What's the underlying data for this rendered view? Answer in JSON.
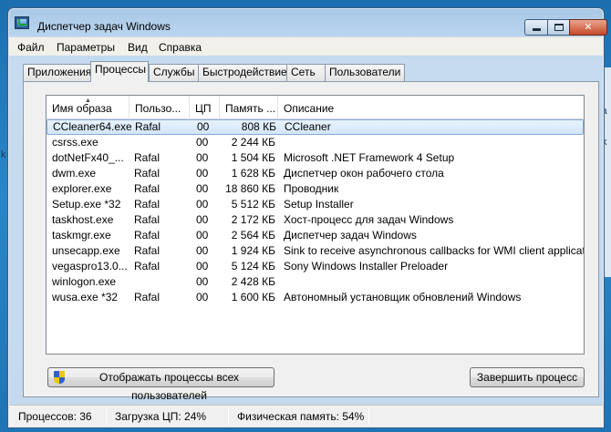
{
  "window": {
    "title": "Диспетчер задач Windows",
    "controls": {
      "minimize": "",
      "maximize": "",
      "close": "✕"
    }
  },
  "menu": [
    "Файл",
    "Параметры",
    "Вид",
    "Справка"
  ],
  "tabs": [
    "Приложения",
    "Процессы",
    "Службы",
    "Быстродействие",
    "Сеть",
    "Пользователи"
  ],
  "active_tab": "Процессы",
  "columns": [
    "Имя образа",
    "Пользо...",
    "ЦП",
    "Память ...",
    "Описание"
  ],
  "sort_indicator": "▲",
  "processes": [
    {
      "name": "CCleaner64.exe",
      "user": "Rafal",
      "cpu": "00",
      "mem": "808 КБ",
      "desc": "CCleaner"
    },
    {
      "name": "csrss.exe",
      "user": "",
      "cpu": "00",
      "mem": "2 244 КБ",
      "desc": ""
    },
    {
      "name": "dotNetFx40_...",
      "user": "Rafal",
      "cpu": "00",
      "mem": "1 504 КБ",
      "desc": "Microsoft .NET Framework 4 Setup"
    },
    {
      "name": "dwm.exe",
      "user": "Rafal",
      "cpu": "00",
      "mem": "1 628 КБ",
      "desc": "Диспетчер окон рабочего стола"
    },
    {
      "name": "explorer.exe",
      "user": "Rafal",
      "cpu": "00",
      "mem": "18 860 КБ",
      "desc": "Проводник"
    },
    {
      "name": "Setup.exe *32",
      "user": "Rafal",
      "cpu": "00",
      "mem": "5 512 КБ",
      "desc": "Setup Installer"
    },
    {
      "name": "taskhost.exe",
      "user": "Rafal",
      "cpu": "00",
      "mem": "2 172 КБ",
      "desc": "Хост-процесс для задач Windows"
    },
    {
      "name": "taskmgr.exe",
      "user": "Rafal",
      "cpu": "00",
      "mem": "2 564 КБ",
      "desc": "Диспетчер задач Windows"
    },
    {
      "name": "unsecapp.exe",
      "user": "Rafal",
      "cpu": "00",
      "mem": "1 924 КБ",
      "desc": "Sink to receive asynchronous callbacks for WMI client application"
    },
    {
      "name": "vegaspro13.0...",
      "user": "Rafal",
      "cpu": "00",
      "mem": "5 124 КБ",
      "desc": "Sony Windows Installer Preloader"
    },
    {
      "name": "winlogon.exe",
      "user": "",
      "cpu": "00",
      "mem": "2 428 КБ",
      "desc": ""
    },
    {
      "name": "wusa.exe *32",
      "user": "Rafal",
      "cpu": "00",
      "mem": "1 600 КБ",
      "desc": "Автономный установщик обновлений Windows"
    }
  ],
  "selected_index": 0,
  "buttons": {
    "show_all": "Отображать процессы всех пользователей",
    "end_process": "Завершить процесс"
  },
  "status": {
    "processes": "Процессов: 36",
    "cpu": "Загрузка ЦП: 24%",
    "memory": "Физическая память: 54%"
  },
  "desktop_text": {
    "left_char": "k",
    "right_a": "la",
    "right_b": "k"
  }
}
